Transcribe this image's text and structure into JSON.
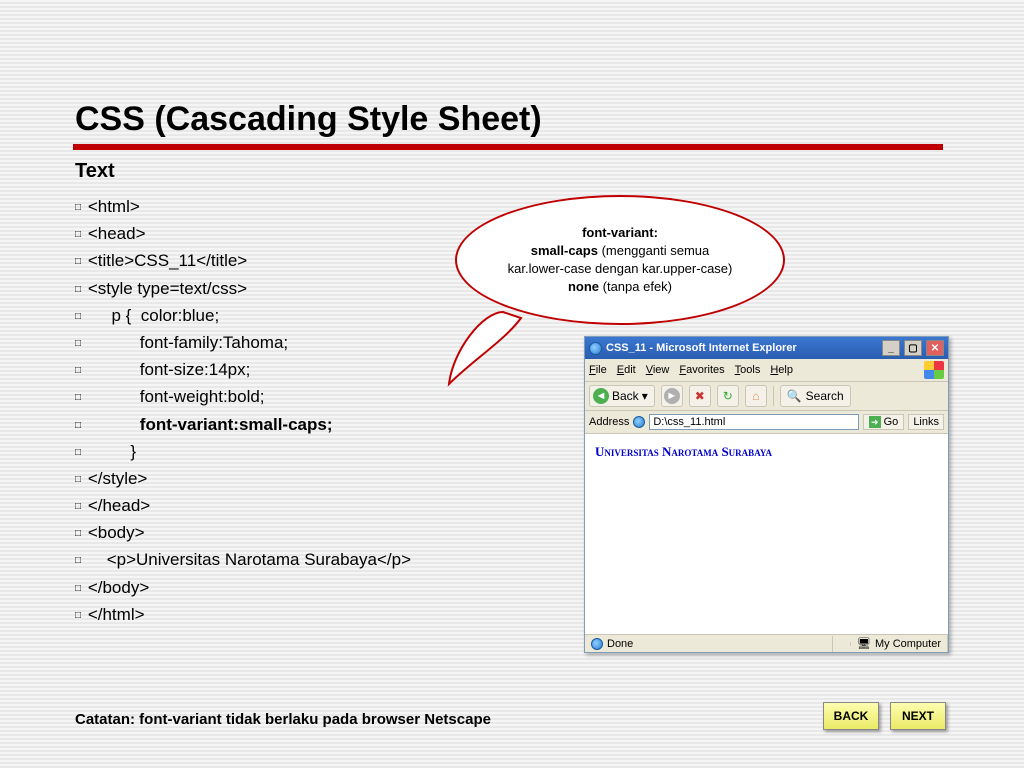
{
  "slide": {
    "title": "CSS (Cascading Style Sheet)",
    "subhead": "Text",
    "code_lines": [
      "<html>",
      "<head>",
      "<title>CSS_11</title>",
      "<style type=text/css>",
      "     p {  color:blue;",
      "           font-family:Tahoma;",
      "           font-size:14px;",
      "           font-weight:bold;",
      "           font-variant:small-caps;",
      "         }",
      "</style>",
      "</head>",
      "<body>",
      "    <p>Universitas Narotama Surabaya</p>",
      "</body>",
      "</html>"
    ],
    "code_bold_index": 8,
    "note": "Catatan: font-variant tidak berlaku pada browser Netscape"
  },
  "callout": {
    "line1_bold": "font-variant:",
    "line2_bold": "small-caps",
    "line2_rest": " (mengganti semua",
    "line3": "kar.lower-case dengan kar.upper-case)",
    "line4_bold": "none",
    "line4_rest": " (tanpa efek)"
  },
  "browser": {
    "title": "CSS_11 - Microsoft Internet Explorer",
    "menus": [
      "File",
      "Edit",
      "View",
      "Favorites",
      "Tools",
      "Help"
    ],
    "back_label": "Back",
    "search_label": "Search",
    "address_label": "Address",
    "address_value": "D:\\css_11.html",
    "go_label": "Go",
    "links_label": "Links",
    "page_text": "Universitas Narotama Surabaya",
    "status_done": "Done",
    "status_zone": "My Computer"
  },
  "nav": {
    "back": "BACK",
    "next": "NEXT"
  }
}
